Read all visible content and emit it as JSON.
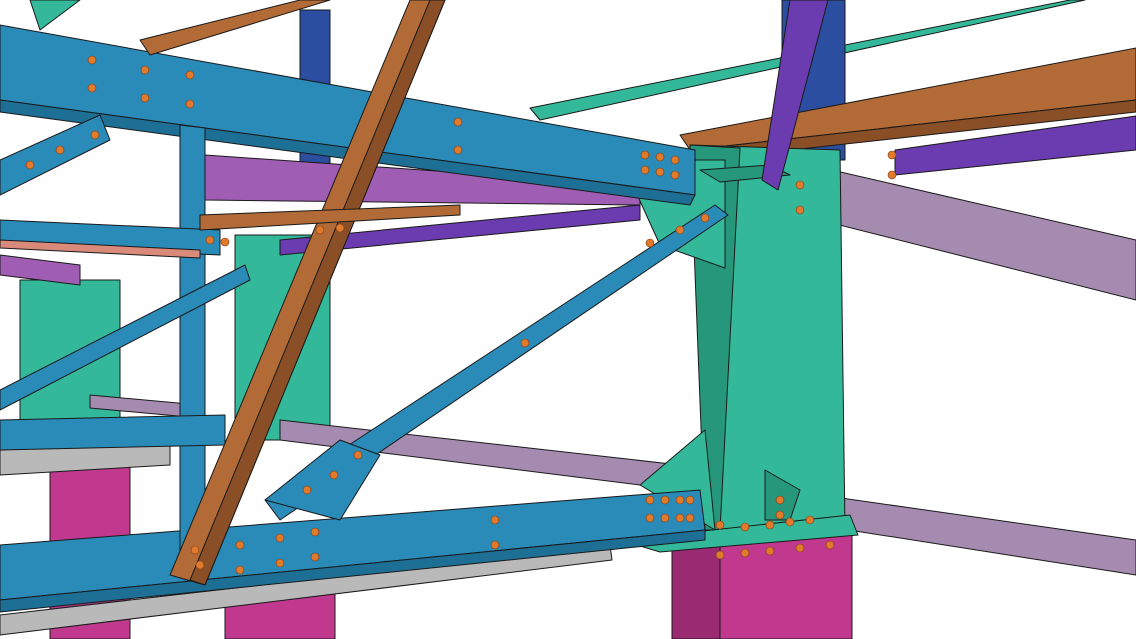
{
  "scene": {
    "description_visible_text": "",
    "colors": {
      "background": "#ffffff",
      "steel_blue": "#2a8ab8",
      "steel_blue_dark": "#1e6f96",
      "teal": "#33b999",
      "teal_dark": "#27977c",
      "brown": "#b26a36",
      "brown_dark": "#8a4f27",
      "purple": "#a05db4",
      "violet": "#6a3cb0",
      "lilac": "#a58bb0",
      "magenta": "#c0398f",
      "magenta_dark": "#9a2b73",
      "navy": "#2b4ea0",
      "salmon": "#d98a7a",
      "grey": "#b9b9b9",
      "bolt": "#e07a2c",
      "outline": "#1a1a1a"
    },
    "icons": []
  }
}
